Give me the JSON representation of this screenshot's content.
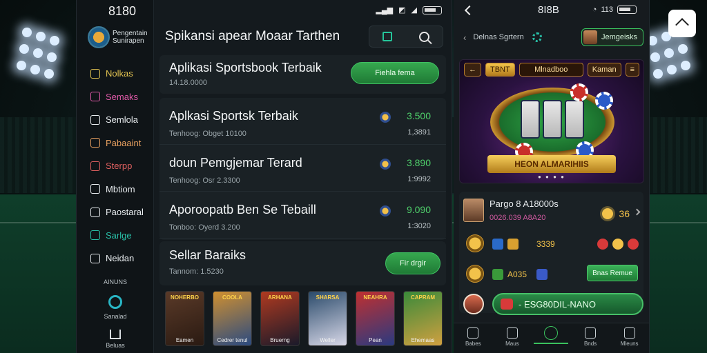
{
  "left_phone": {
    "time": "8180",
    "brand_name": "Pengentain Sunirapen",
    "nav_items": [
      {
        "label": "Nolkas",
        "color": "#e0c150"
      },
      {
        "label": "Semaks",
        "color": "#e05aa8"
      },
      {
        "label": "Semlola",
        "color": "#e8ecef"
      },
      {
        "label": "Pabaaint",
        "color": "#e8a060"
      },
      {
        "label": "Sterpp",
        "color": "#e06060"
      },
      {
        "label": "Mbtiom",
        "color": "#e8ecef"
      },
      {
        "label": "Paostaral",
        "color": "#e8ecef"
      },
      {
        "label": "Sarlge",
        "color": "#29c0a8"
      },
      {
        "label": "Neidan",
        "color": "#e8ecef"
      }
    ],
    "section_label": "AINUNS",
    "section_item": "Sanalad",
    "home_label": "Beluas",
    "header_title": "Spikansi apear Moaar Tarthen",
    "featured": {
      "title": "Aplikasi Sportsbook Terbaik",
      "subtitle": "14.18.0000",
      "button": "Fiehla fema"
    },
    "rows": [
      {
        "title": "Aplkasi Sportsk Terbaik",
        "sub": "Tenhoog: Obget 10100",
        "value": "3.500",
        "value2": "1,3891"
      },
      {
        "title": "doun Pemgjemar Terard",
        "sub": "Tenhoog: Osr 2.3300",
        "value": "3.890",
        "value2": "1:9992"
      },
      {
        "title": "Aporoopatb Ben Se Tebaill",
        "sub": "Tonboo: Oyerd 3.200",
        "value": "9.090",
        "value2": "1:3020"
      }
    ],
    "last_card": {
      "title": "Sellar Baraiks",
      "sub": "Tannom: 1.5230",
      "button": "Fir drgir"
    },
    "thumbs": [
      {
        "cap": "NOHERBO",
        "label": "Eamen",
        "c1": "#5a3a28",
        "c2": "#2a1a12"
      },
      {
        "cap": "COOLA",
        "label": "Cedrer tenul",
        "c1": "#d09030",
        "c2": "#2a4a80"
      },
      {
        "cap": "ARHANA",
        "label": "Bruerng",
        "c1": "#b03a20",
        "c2": "#1a1a2a"
      },
      {
        "cap": "SHARSA",
        "label": "Weller",
        "c1": "#2a4a6a",
        "c2": "#d8d8e8"
      },
      {
        "cap": "NEAHRA",
        "label": "Pean",
        "c1": "#c03030",
        "c2": "#2a3a80"
      },
      {
        "cap": "CAPRAM",
        "label": "Ehemaas",
        "c1": "#3a8a3a",
        "c2": "#d0a040"
      }
    ]
  },
  "right_phone": {
    "time": "8I8B",
    "status": "113",
    "breadcrumb": "Delnas Sgrtern",
    "user_pill": "Jemgeisks",
    "game_tabs": [
      "TBNT",
      "Mlnadboo",
      "Kaman"
    ],
    "game_banner": "HEON ALMARIHIIS",
    "profile": {
      "title": "Pargo 8 A18000s",
      "line": "0026.039 A8A20",
      "count": "36"
    },
    "stats": [
      "3339",
      "A035"
    ],
    "green_button": "Bnas Remue",
    "promo_text": "- ESG80DIL-NANO",
    "tabs": [
      {
        "label": "Babes"
      },
      {
        "label": "Maus"
      },
      {
        "label": "",
        "active": true
      },
      {
        "label": "Bnds"
      },
      {
        "label": "Mleuns"
      }
    ]
  }
}
